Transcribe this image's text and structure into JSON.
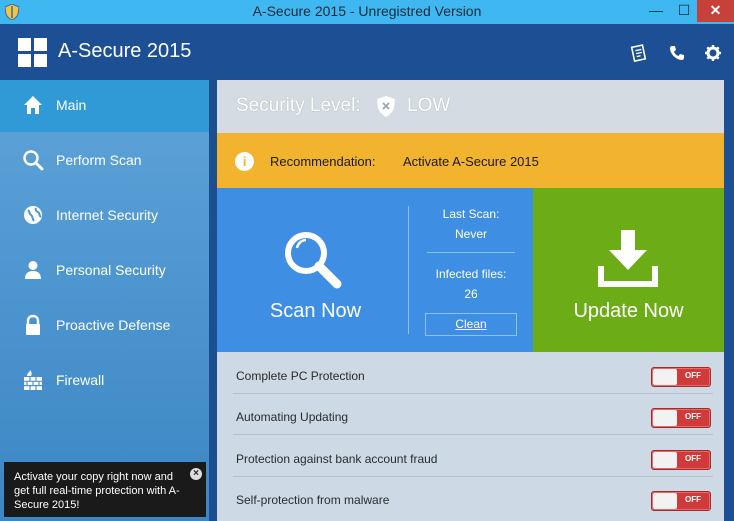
{
  "window": {
    "title": "A-Secure 2015 - Unregistred Version",
    "minimize_glyph": "—",
    "maximize_glyph": "☐",
    "close_glyph": "✕"
  },
  "header": {
    "brand": "A-Secure 2015",
    "icons": [
      "document-icon",
      "phone-icon",
      "gear-icon"
    ]
  },
  "sidebar": {
    "items": [
      {
        "label": "Main",
        "icon": "home-icon",
        "active": true
      },
      {
        "label": "Perform Scan",
        "icon": "search-icon",
        "active": false
      },
      {
        "label": "Internet Security",
        "icon": "globe-icon",
        "active": false
      },
      {
        "label": "Personal Security",
        "icon": "person-icon",
        "active": false
      },
      {
        "label": "Proactive Defense",
        "icon": "lock-icon",
        "active": false
      },
      {
        "label": "Firewall",
        "icon": "firewall-icon",
        "active": false
      }
    ],
    "promo": {
      "text": "Activate your copy right now and get full real-time protection with A-Secure 2015!",
      "close_glyph": "×"
    }
  },
  "main": {
    "security_level": {
      "label": "Security Level:",
      "value": "LOW"
    },
    "recommendation": {
      "info_glyph": "i",
      "label": "Recommendation:",
      "value": "Activate A-Secure 2015"
    },
    "scan": {
      "button_label": "Scan Now",
      "last_scan_label": "Last Scan:",
      "last_scan_value": "Never",
      "infected_label": "Infected files:",
      "infected_value": "26",
      "clean_label": "Clean"
    },
    "update": {
      "button_label": "Update Now"
    },
    "protections": [
      {
        "name": "Complete PC Protection",
        "state": "OFF"
      },
      {
        "name": "Automating Updating",
        "state": "OFF"
      },
      {
        "name": "Protection against bank account fraud",
        "state": "OFF"
      },
      {
        "name": "Self-protection from malware",
        "state": "OFF"
      }
    ]
  },
  "colors": {
    "title_bar": "#3fb8f1",
    "header": "#1c4f93",
    "sidebar_active": "#2f9ad6",
    "recommendation_bar": "#f2b32e",
    "scan_panel": "#3e8ee3",
    "update_panel": "#6cac17",
    "toggle_off": "#d03a3a"
  }
}
